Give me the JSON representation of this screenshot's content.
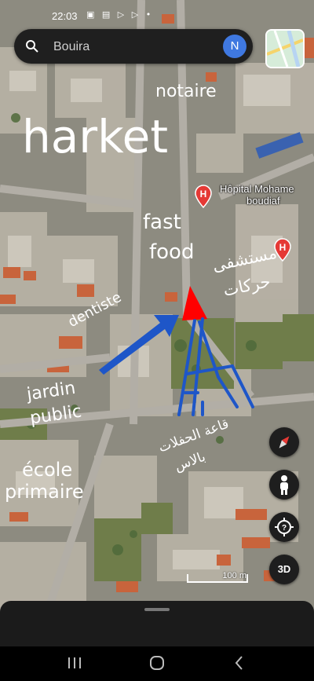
{
  "status_bar": {
    "time": "22:03",
    "icons": "▣ ▤ ▷ ▷ •"
  },
  "search": {
    "placeholder": "Bouira",
    "avatar_letter": "N"
  },
  "handwritten_labels": [
    {
      "text": "notaire",
      "size": 22
    },
    {
      "text": "harket",
      "size": 58
    },
    {
      "text": "fast",
      "size": 26
    },
    {
      "text": "food",
      "size": 26
    },
    {
      "text": "مستشفى",
      "size": 21
    },
    {
      "text": "حركات",
      "size": 21
    },
    {
      "text": "dentiste",
      "size": 18
    },
    {
      "text": "jardin",
      "size": 22
    },
    {
      "text": "public",
      "size": 22
    },
    {
      "text": "قاعة الحفلات",
      "size": 17
    },
    {
      "text": "بالاس",
      "size": 17
    },
    {
      "text": "école",
      "size": 24
    },
    {
      "text": "primaire",
      "size": 24
    }
  ],
  "map_labels": {
    "hospital_line1": "Hôpital Mohame",
    "hospital_line2": "boudiaf"
  },
  "icons": [
    "search-icon",
    "hospital-pin-icon",
    "compass-icon",
    "pegman-icon",
    "locate-icon",
    "layers-thumbnail"
  ],
  "controls": {
    "mode_3d": "3D"
  },
  "scale": {
    "label": "100 m"
  },
  "colors": {
    "marker_red": "#ff0000",
    "arrow_blue": "#1e56c8",
    "hospital_pin": "#e53935",
    "avatar": "#3f78e0"
  }
}
